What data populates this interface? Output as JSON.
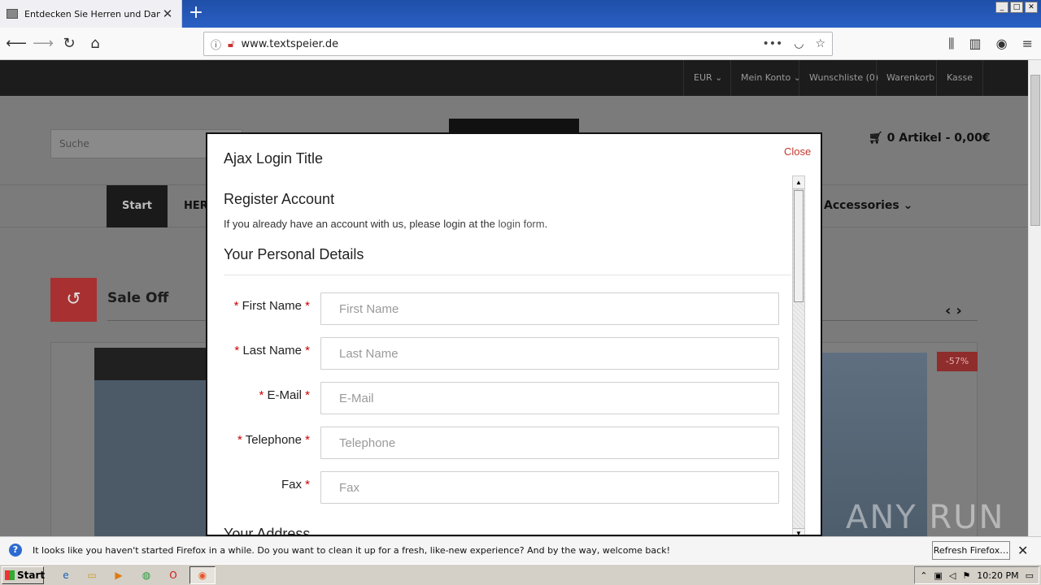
{
  "browser": {
    "tab_title": "Entdecken Sie Herren und Damen",
    "url": "www.textspeier.de",
    "window_buttons": [
      "_",
      "□",
      "✕"
    ]
  },
  "site": {
    "top_links": [
      "EUR",
      "Mein Konto",
      "Wunschliste (0)",
      "Warenkorb",
      "Kasse"
    ],
    "search_placeholder": "Suche",
    "cart": "0 Artikel - 0,00€",
    "menu_start": "Start",
    "menu_her": "HER",
    "menu_accessories": "Accessories",
    "sale_title": "Sale Off",
    "discount_badge": "-57%",
    "watermark": "ANY RUN"
  },
  "modal": {
    "title": "Ajax Login Title",
    "close": "Close",
    "register_title": "Register Account",
    "intro_text": "If you already have an account with us, please login at the ",
    "intro_link": "login form",
    "intro_end": ".",
    "personal_title": "Your Personal Details",
    "address_title": "Your Address",
    "fields": [
      {
        "label": "First Name",
        "placeholder": "First Name",
        "req_left": true
      },
      {
        "label": "Last Name",
        "placeholder": "Last Name",
        "req_left": true
      },
      {
        "label": "E-Mail",
        "placeholder": "E-Mail",
        "req_left": true
      },
      {
        "label": "Telephone",
        "placeholder": "Telephone",
        "req_left": true
      },
      {
        "label": "Fax",
        "placeholder": "Fax",
        "req_left": false
      }
    ]
  },
  "notification": {
    "message": "It looks like you haven't started Firefox in a while. Do you want to clean it up for a fresh, like-new experience? And by the way, welcome back!",
    "button": "Refresh Firefox…"
  },
  "taskbar": {
    "start": "Start",
    "clock": "10:20 PM"
  }
}
